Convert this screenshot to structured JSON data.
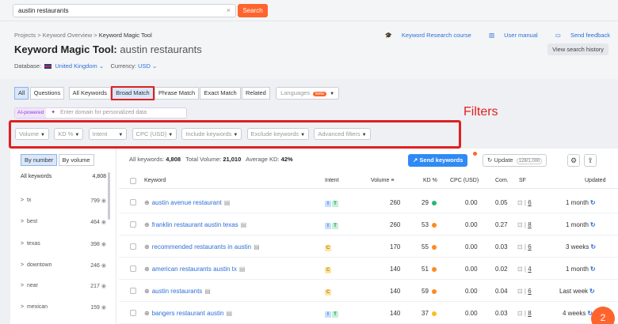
{
  "search": {
    "value": "austin restaurants",
    "clear": "×",
    "button": "Search"
  },
  "breadcrumb": [
    "Projects",
    ">",
    "Keyword Overview",
    ">",
    "Keyword Magic Tool"
  ],
  "title": {
    "tool": "Keyword Magic Tool:",
    "query": "austin restaurants"
  },
  "database": {
    "label": "Database:",
    "value": "United Kingdom",
    "currency_label": "Currency:",
    "currency": "USD"
  },
  "toplinks": {
    "course": "Keyword Research course",
    "manual": "User manual",
    "feedback": "Send feedback"
  },
  "history_button": "View search history",
  "tabs": [
    "All",
    "Questions",
    "All Keywords",
    "Broad Match",
    "Phrase Match",
    "Exact Match",
    "Related"
  ],
  "languages": {
    "label": "Languages",
    "badge": "beta"
  },
  "ai": {
    "tag": "AI-powered",
    "placeholder": "Enter domain for personalized data"
  },
  "filters_label": "Filters",
  "filters": [
    "Volume",
    "KD %",
    "Intent",
    "CPC (USD)",
    "Include keywords",
    "Exclude keywords",
    "Advanced filters"
  ],
  "toggle": {
    "by_number": "By number",
    "by_volume": "By volume"
  },
  "groups_header": {
    "label": "All keywords",
    "count": "4,808"
  },
  "groups": [
    {
      "name": "tx",
      "count": "799"
    },
    {
      "name": "best",
      "count": "464"
    },
    {
      "name": "texas",
      "count": "398"
    },
    {
      "name": "downtown",
      "count": "246"
    },
    {
      "name": "near",
      "count": "217"
    },
    {
      "name": "mexican",
      "count": "159"
    }
  ],
  "summary": {
    "all_label": "All keywords:",
    "all_value": "4,808",
    "volume_label": "Total Volume:",
    "volume_value": "21,010",
    "kd_label": "Average KD:",
    "kd_value": "42%"
  },
  "send_button": "Send keywords",
  "update": {
    "label": "Update",
    "count": "128/1,000"
  },
  "columns": {
    "keyword": "Keyword",
    "intent": "Intent",
    "volume": "Volume",
    "kd": "KD %",
    "cpc": "CPC (USD)",
    "com": "Com.",
    "sf": "SF",
    "updated": "Updated"
  },
  "colors": {
    "kd_green": "#2bb673",
    "kd_orange": "#ff8a1f",
    "kd_yellow": "#f6c01e",
    "accent": "#ff642d",
    "link": "#2f6fd6"
  },
  "rows": [
    {
      "keyword": "austin avenue restaurant",
      "intent": [
        "I",
        "T"
      ],
      "volume": "260",
      "kd": "29",
      "kd_color": "#2bb673",
      "cpc": "0.00",
      "com": "0.05",
      "sf": "6",
      "updated": "1 month"
    },
    {
      "keyword": "franklin restaurant austin texas",
      "intent": [
        "I",
        "T"
      ],
      "volume": "260",
      "kd": "53",
      "kd_color": "#ff8a1f",
      "cpc": "0.00",
      "com": "0.27",
      "sf": "8",
      "updated": "1 month"
    },
    {
      "keyword": "recommended restaurants in austin",
      "intent": [
        "C"
      ],
      "volume": "170",
      "kd": "55",
      "kd_color": "#ff8a1f",
      "cpc": "0.00",
      "com": "0.03",
      "sf": "6",
      "updated": "3 weeks"
    },
    {
      "keyword": "american restaurants austin tx",
      "intent": [
        "C"
      ],
      "volume": "140",
      "kd": "51",
      "kd_color": "#ff8a1f",
      "cpc": "0.00",
      "com": "0.02",
      "sf": "4",
      "updated": "1 month"
    },
    {
      "keyword": "austin restaurants",
      "intent": [
        "C"
      ],
      "volume": "140",
      "kd": "59",
      "kd_color": "#ff8a1f",
      "cpc": "0.00",
      "com": "0.04",
      "sf": "6",
      "updated": "Last week"
    },
    {
      "keyword": "bangers restaurant austin",
      "intent": [
        "I",
        "T"
      ],
      "volume": "140",
      "kd": "37",
      "kd_color": "#f6c01e",
      "cpc": "0.00",
      "com": "0.03",
      "sf": "8",
      "updated": "4 weeks"
    }
  ],
  "corner_badge": "2"
}
